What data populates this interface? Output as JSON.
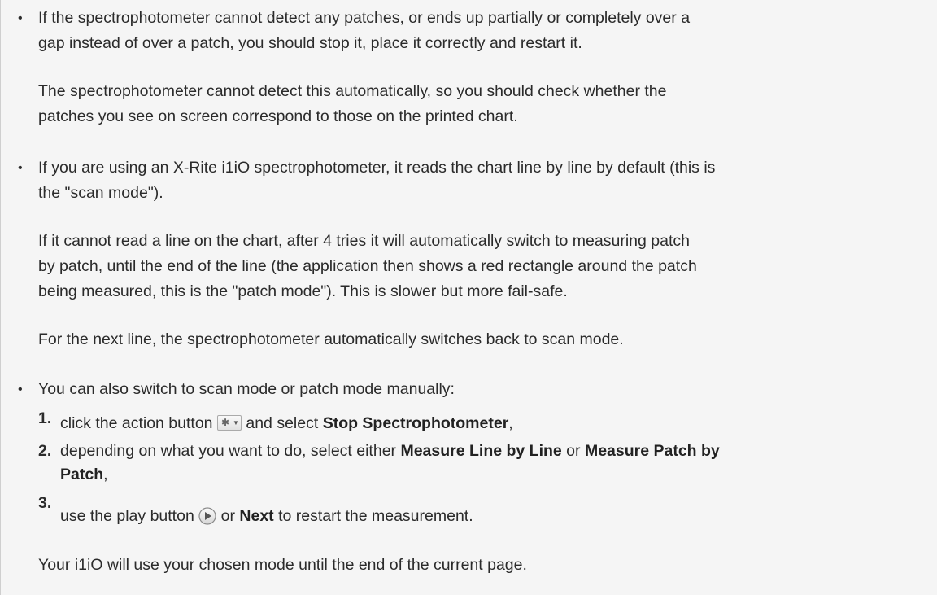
{
  "bullets": [
    {
      "marker": "•",
      "p1": "If the spectrophotometer cannot detect any patches, or ends up partially or completely over a",
      "p1b": "gap instead of over a patch, you should stop it, place it correctly and restart it.",
      "p2": "The spectrophotometer cannot detect this automatically, so you should check whether the",
      "p2b": "patches you see on screen correspond to those on the printed chart."
    },
    {
      "marker": "•",
      "p1": "If you are using an X-Rite i1iO spectrophotometer, it reads the chart line by line by default (this is",
      "p1b": "the \"scan mode\").",
      "p2": "If it cannot read a line on the chart, after 4 tries it will automatically switch to measuring patch",
      "p2b": "by patch, until the end of the line (the application then shows a red rectangle around the patch",
      "p2c": "being measured, this is the \"patch mode\"). This is slower but more fail-safe.",
      "p3": "For the next line, the spectrophotometer automatically switches back to scan mode."
    },
    {
      "marker": "•",
      "p1": "You can also switch to scan mode or patch mode manually:"
    }
  ],
  "steps": [
    {
      "num": "1.",
      "before": "click the action button ",
      "after": " and select ",
      "bold": "Stop Spectrophotometer",
      "end": ","
    },
    {
      "num": "2.",
      "before": "depending on what you want to do, select either ",
      "bold1": "Measure Line by Line",
      "mid": " or ",
      "bold2": "Measure Patch by",
      "bold2b": "Patch",
      "end": ","
    },
    {
      "num": "3.",
      "before": "use the play button ",
      "mid": " or ",
      "bold": "Next",
      "end": " to restart the measurement."
    }
  ],
  "closing": "Your i1iO will use your chosen mode until the end of the current page.",
  "icons": {
    "action_button": "gear-dropdown-icon",
    "play_button": "play-circle-icon"
  },
  "colors": {
    "background": "#f5f5f5",
    "text": "#2b2b2b"
  }
}
